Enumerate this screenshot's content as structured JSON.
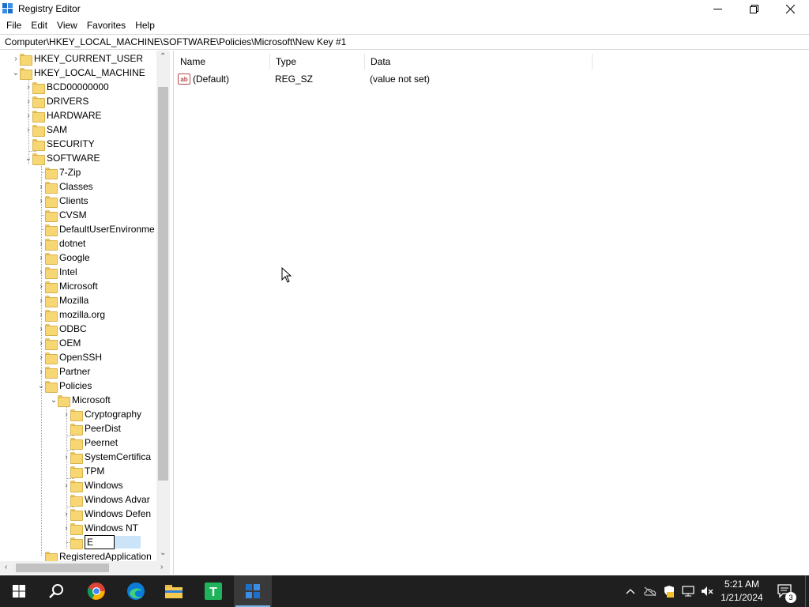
{
  "window": {
    "title": "Registry Editor"
  },
  "menu": [
    "File",
    "Edit",
    "View",
    "Favorites",
    "Help"
  ],
  "address": "Computer\\HKEY_LOCAL_MACHINE\\SOFTWARE\\Policies\\Microsoft\\New Key #1",
  "tree": {
    "items": [
      {
        "label": "HKEY_CURRENT_USER",
        "level": 1,
        "expander": "collapsed"
      },
      {
        "label": "HKEY_LOCAL_MACHINE",
        "level": 1,
        "expander": "expanded"
      },
      {
        "label": "BCD00000000",
        "level": 2,
        "expander": "collapsed"
      },
      {
        "label": "DRIVERS",
        "level": 2,
        "expander": "collapsed"
      },
      {
        "label": "HARDWARE",
        "level": 2,
        "expander": "collapsed"
      },
      {
        "label": "SAM",
        "level": 2,
        "expander": "collapsed"
      },
      {
        "label": "SECURITY",
        "level": 2,
        "expander": "none"
      },
      {
        "label": "SOFTWARE",
        "level": 2,
        "expander": "expanded"
      },
      {
        "label": "7-Zip",
        "level": 3,
        "expander": "none"
      },
      {
        "label": "Classes",
        "level": 3,
        "expander": "collapsed"
      },
      {
        "label": "Clients",
        "level": 3,
        "expander": "collapsed"
      },
      {
        "label": "CVSM",
        "level": 3,
        "expander": "none"
      },
      {
        "label": "DefaultUserEnvironme",
        "level": 3,
        "expander": "none"
      },
      {
        "label": "dotnet",
        "level": 3,
        "expander": "collapsed"
      },
      {
        "label": "Google",
        "level": 3,
        "expander": "collapsed"
      },
      {
        "label": "Intel",
        "level": 3,
        "expander": "collapsed"
      },
      {
        "label": "Microsoft",
        "level": 3,
        "expander": "collapsed"
      },
      {
        "label": "Mozilla",
        "level": 3,
        "expander": "collapsed"
      },
      {
        "label": "mozilla.org",
        "level": 3,
        "expander": "collapsed"
      },
      {
        "label": "ODBC",
        "level": 3,
        "expander": "collapsed"
      },
      {
        "label": "OEM",
        "level": 3,
        "expander": "collapsed"
      },
      {
        "label": "OpenSSH",
        "level": 3,
        "expander": "collapsed"
      },
      {
        "label": "Partner",
        "level": 3,
        "expander": "collapsed"
      },
      {
        "label": "Policies",
        "level": 3,
        "expander": "expanded"
      },
      {
        "label": "Microsoft",
        "level": 4,
        "expander": "expanded"
      },
      {
        "label": "Cryptography",
        "level": 5,
        "expander": "collapsed"
      },
      {
        "label": "PeerDist",
        "level": 5,
        "expander": "none"
      },
      {
        "label": "Peernet",
        "level": 5,
        "expander": "none"
      },
      {
        "label": "SystemCertifica",
        "level": 5,
        "expander": "collapsed"
      },
      {
        "label": "TPM",
        "level": 5,
        "expander": "none"
      },
      {
        "label": "Windows",
        "level": 5,
        "expander": "collapsed"
      },
      {
        "label": "Windows Advar",
        "level": 5,
        "expander": "none"
      },
      {
        "label": "Windows Defen",
        "level": 5,
        "expander": "collapsed"
      },
      {
        "label": "Windows NT",
        "level": 5,
        "expander": "collapsed"
      },
      {
        "label": "E",
        "level": 5,
        "expander": "none",
        "editing": true
      },
      {
        "label": "RegisteredApplication",
        "level": 3,
        "expander": "none"
      }
    ]
  },
  "list": {
    "columns": [
      "Name",
      "Type",
      "Data"
    ],
    "rows": [
      {
        "name": "(Default)",
        "type": "REG_SZ",
        "data": "(value not set)",
        "icon": "string-value-icon"
      }
    ]
  },
  "taskbar": {
    "apps": [
      "start-icon",
      "search-icon",
      "chrome-icon",
      "edge-icon",
      "file-explorer-icon",
      "t-app-icon",
      "regedit-icon"
    ],
    "time": "5:21 AM",
    "date": "1/21/2024",
    "notification_count": "3"
  }
}
